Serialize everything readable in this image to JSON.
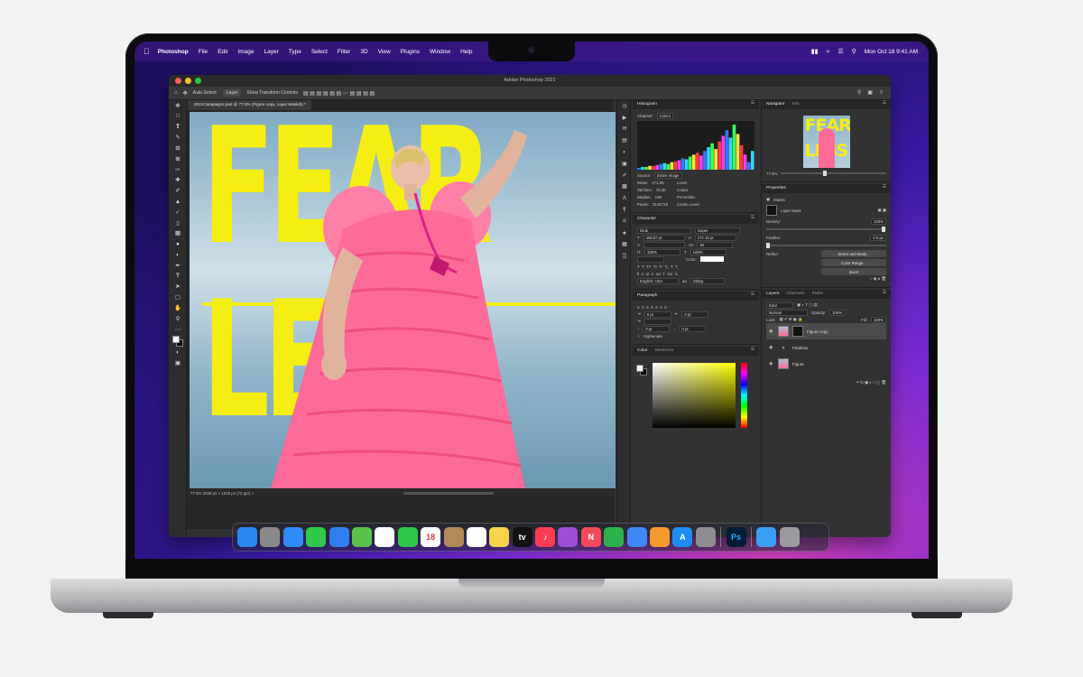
{
  "menubar": {
    "apple_icon": "apple-logo-icon",
    "app_name": "Photoshop",
    "items": [
      "File",
      "Edit",
      "Image",
      "Layer",
      "Type",
      "Select",
      "Filter",
      "3D",
      "View",
      "Plugins",
      "Window",
      "Help"
    ],
    "clock": "Mon Oct 18  9:41 AM"
  },
  "window": {
    "title": "Adobe Photoshop 2021",
    "doc_tab": "2021Campaign2.psd @ 77.5% (Figure copy, Layer Mask/8) *",
    "options": {
      "auto_select": "Auto-Select:",
      "target": "Layer",
      "transform_controls": "Show Transform Controls"
    },
    "status": "77.5%     2048 px × 1536 px (72 ppi)   >"
  },
  "artwork": {
    "line1": "FEAR",
    "line2": "LESS",
    "colors": {
      "text": "#f5ee12",
      "sky": "#a7c5d4",
      "dress": "#ff6b98"
    }
  },
  "tools": [
    "move",
    "marquee",
    "lasso",
    "quick-select",
    "crop",
    "frame",
    "eyedropper",
    "spot-heal",
    "brush",
    "stamp",
    "history-brush",
    "eraser",
    "gradient",
    "blur",
    "dodge",
    "pen",
    "type",
    "path-select",
    "rectangle",
    "hand",
    "zoom",
    "more"
  ],
  "histogram": {
    "title": "Histogram",
    "channel_label": "Channel:",
    "channel": "Colors",
    "source_label": "Source:",
    "source": "Entire Image",
    "stats": [
      [
        "Mean:",
        "171.06"
      ],
      [
        "Std Dev:",
        "72.30"
      ],
      [
        "Median:",
        "198"
      ],
      [
        "Pixels:",
        "3145728"
      ]
    ],
    "stats_right": [
      "Level:",
      "Count:",
      "Percentile:",
      "Cache Level:"
    ],
    "bars": [
      2,
      3,
      3,
      4,
      4,
      5,
      6,
      7,
      6,
      8,
      9,
      10,
      12,
      11,
      14,
      16,
      18,
      15,
      20,
      24,
      28,
      22,
      30,
      36,
      42,
      34,
      48,
      38,
      26,
      16,
      8,
      20
    ]
  },
  "character": {
    "title": "Character",
    "font": "Druk",
    "style": "Super",
    "size": "160.87 pt",
    "leading": "172.18 pt",
    "tracking": "50",
    "scale_v": "100%",
    "scale_h": "100%",
    "color_label": "Color:",
    "language": "English: USA",
    "antialias": "Sharp"
  },
  "paragraph": {
    "title": "Paragraph",
    "indent_left": "0 pt",
    "indent_right": "0 pt",
    "space_before": "0 pt",
    "space_after": "0 pt",
    "hyphenate": "Hyphenate"
  },
  "color_panel": {
    "title": "Color",
    "tab2": "Swatches"
  },
  "navigator": {
    "title": "Navigator",
    "tab2": "Info",
    "zoom": "77.5%"
  },
  "properties": {
    "title": "Properties",
    "kind": "Masks",
    "mask_label": "Layer Mask",
    "density_label": "Density:",
    "density": "100%",
    "feather_label": "Feather:",
    "feather": "0.0 px",
    "refine_label": "Refine:",
    "btn_select": "Select and Mask...",
    "btn_color": "Color Range...",
    "btn_invert": "Invert"
  },
  "layers": {
    "tabs": [
      "Layers",
      "Channels",
      "Paths"
    ],
    "filter": "Kind",
    "blend": "Normal",
    "opacity_label": "Opacity:",
    "opacity": "100%",
    "lock_label": "Lock:",
    "fill_label": "Fill:",
    "fill": "100%",
    "items": [
      {
        "name": "Figure copy",
        "selected": true
      },
      {
        "name": "Fearless",
        "selected": false
      },
      {
        "name": "Figure",
        "selected": false
      }
    ]
  },
  "dock": {
    "icons": [
      "finder",
      "launchpad",
      "safari",
      "messages",
      "mail",
      "maps",
      "photos",
      "facetime",
      "calendar",
      "contacts",
      "reminders",
      "notes",
      "apple-tv",
      "music",
      "podcasts",
      "news",
      "numbers",
      "keynote",
      "pages",
      "app-store",
      "system-preferences",
      "photoshop",
      "downloads",
      "trash"
    ],
    "colors": [
      "#2b86f0",
      "#8a8a8a",
      "#2e8bf5",
      "#30c84a",
      "#2f7ff0",
      "#5bc24a",
      "#ffffff",
      "#2cc84a",
      "#ffffff",
      "#b08a5a",
      "#ffffff",
      "#f7d54a",
      "#111111",
      "#fa3c55",
      "#9b4fd8",
      "#f24a5a",
      "#2bb24d",
      "#3f87f5",
      "#f59a2f",
      "#1e8cf5",
      "#8e8e93",
      "#001e36",
      "#3aa0f5",
      "#9a9aa0"
    ],
    "labels": [
      "",
      "",
      "",
      "",
      "",
      "",
      "",
      "",
      "18",
      "",
      "",
      "",
      "tv",
      "♪",
      "",
      "N",
      "",
      "",
      "",
      "A",
      "",
      "Ps",
      "",
      ""
    ]
  }
}
